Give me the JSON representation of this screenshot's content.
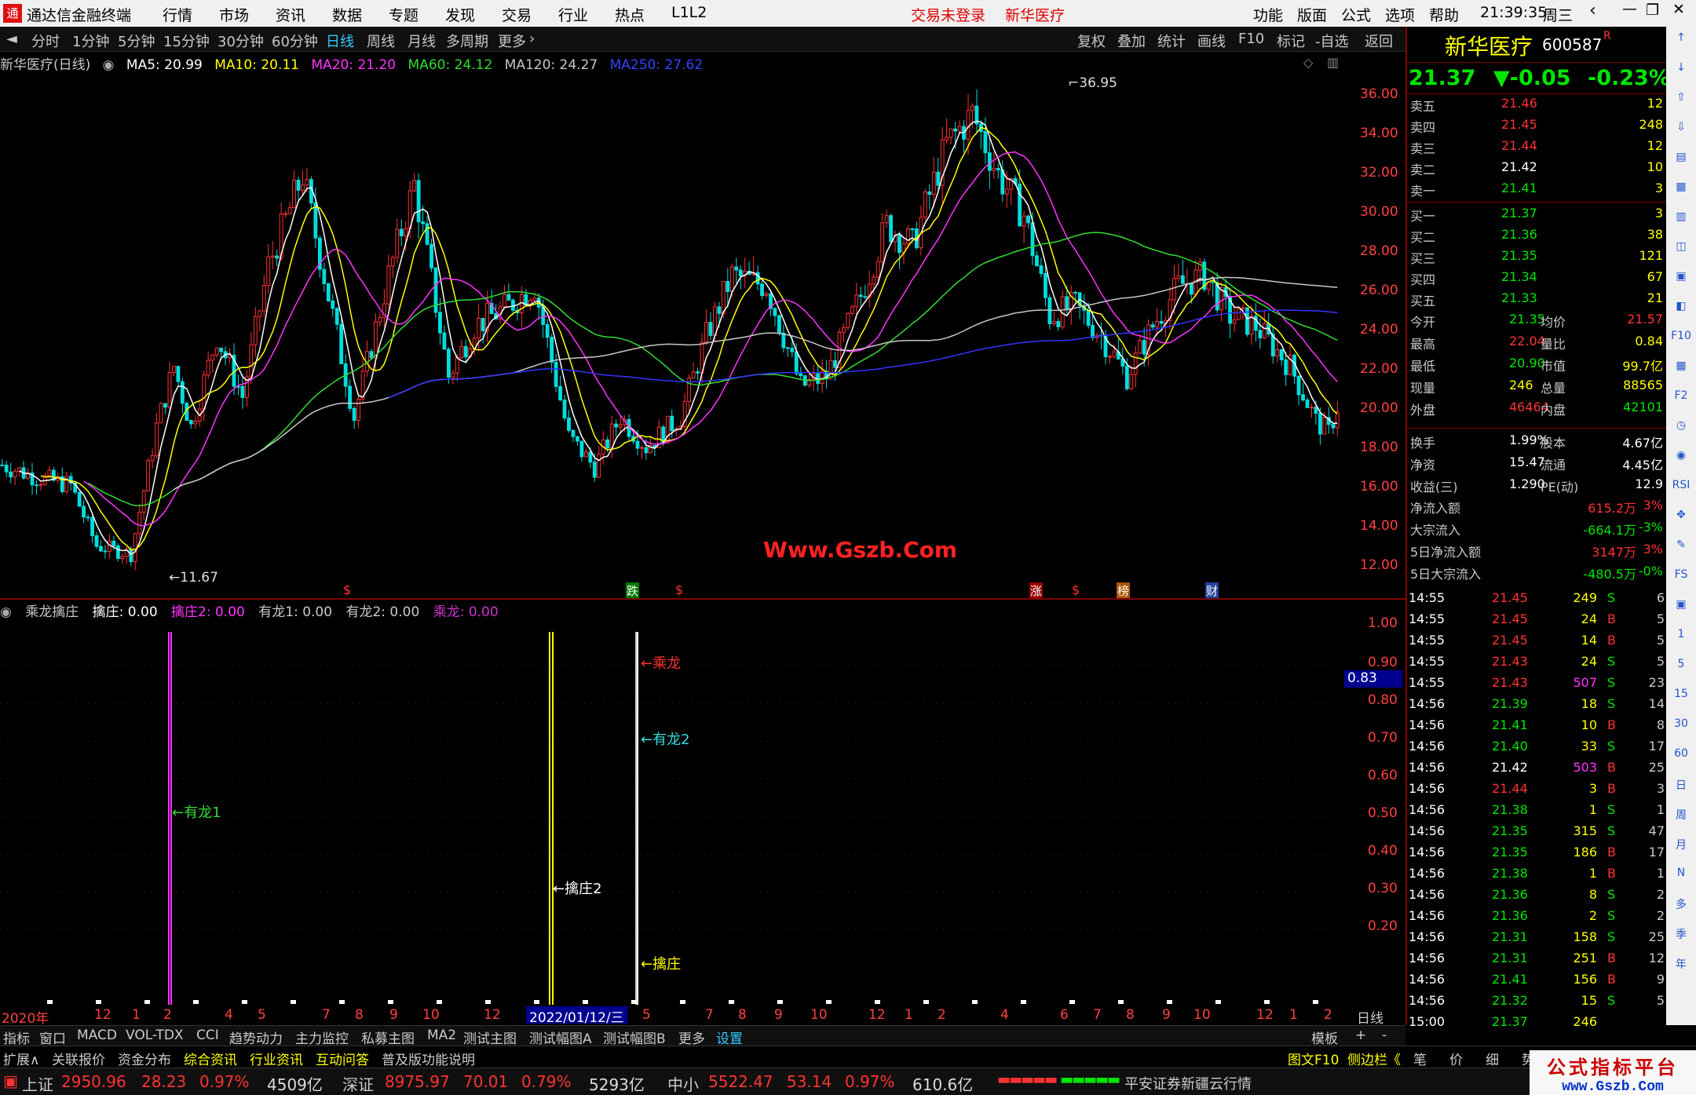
{
  "app": {
    "title": "通达信金融终端",
    "logo_glyph": "通",
    "menu": [
      "行情",
      "市场",
      "资讯",
      "数据",
      "专题",
      "发现",
      "交易",
      "行业",
      "热点",
      "L1L2"
    ],
    "status": [
      "交易未登录",
      "新华医疗"
    ],
    "right_menu": [
      "功能",
      "版面",
      "公式",
      "选项",
      "帮助"
    ],
    "time": "21:39:35",
    "weekday": "周三"
  },
  "timeframes": [
    "分时",
    "1分钟",
    "5分钟",
    "15分钟",
    "30分钟",
    "60分钟",
    "日线",
    "周线",
    "月线",
    "多周期",
    "更多"
  ],
  "active_timeframe": "日线",
  "toolbar": [
    "复权",
    "叠加",
    "统计",
    "画线",
    "F10",
    "标记",
    "-自选",
    "返回"
  ],
  "chart_info": {
    "name": "新华医疗(日线)",
    "ma": [
      {
        "label": "MA5: 20.99",
        "color": "#ffffff"
      },
      {
        "label": "MA10: 20.11",
        "color": "#ffff00"
      },
      {
        "label": "MA20: 21.20",
        "color": "#ff33ff"
      },
      {
        "label": "MA60: 24.12",
        "color": "#33dd33"
      },
      {
        "label": "MA120: 24.27",
        "color": "#c8c8c8"
      },
      {
        "label": "MA250: 27.62",
        "color": "#3333ff"
      }
    ]
  },
  "chart_data": {
    "type": "candlestick",
    "series": [
      {
        "name": "MA5",
        "values": [
          20.99
        ]
      },
      {
        "name": "MA10",
        "values": [
          20.11
        ]
      },
      {
        "name": "MA20",
        "values": [
          21.2
        ]
      },
      {
        "name": "MA60",
        "values": [
          24.12
        ]
      },
      {
        "name": "MA120",
        "values": [
          24.27
        ]
      },
      {
        "name": "MA250",
        "values": [
          27.62
        ]
      }
    ],
    "ylim": [
      11,
      37
    ],
    "y_ticks": [
      "36.00",
      "34.00",
      "32.00",
      "30.00",
      "28.00",
      "26.00",
      "24.00",
      "22.00",
      "20.00",
      "18.00",
      "16.00",
      "14.00",
      "12.00"
    ],
    "annotations": {
      "high": "36.95",
      "low": "11.67"
    },
    "close_path": [
      [
        0,
        17.6
      ],
      [
        8,
        17
      ],
      [
        16,
        16.6
      ],
      [
        22,
        13.6
      ],
      [
        30,
        13.2
      ],
      [
        36,
        19.5
      ],
      [
        40,
        22.5
      ],
      [
        44,
        19.5
      ],
      [
        50,
        24
      ],
      [
        56,
        21
      ],
      [
        62,
        27.5
      ],
      [
        70,
        32
      ],
      [
        76,
        26
      ],
      [
        82,
        20
      ],
      [
        90,
        27
      ],
      [
        96,
        31.5
      ],
      [
        104,
        22
      ],
      [
        110,
        24.5
      ],
      [
        118,
        25.5
      ],
      [
        124,
        26.5
      ],
      [
        132,
        19
      ],
      [
        138,
        17.5
      ],
      [
        144,
        20
      ],
      [
        150,
        18.5
      ],
      [
        158,
        20
      ],
      [
        164,
        24
      ],
      [
        170,
        27
      ],
      [
        178,
        26.5
      ],
      [
        186,
        21.5
      ],
      [
        192,
        22
      ],
      [
        200,
        26
      ],
      [
        206,
        29.5
      ],
      [
        212,
        28.5
      ],
      [
        220,
        33.5
      ],
      [
        226,
        35
      ],
      [
        232,
        32
      ],
      [
        238,
        30
      ],
      [
        244,
        25
      ],
      [
        250,
        25.5
      ],
      [
        256,
        24
      ],
      [
        262,
        22
      ],
      [
        268,
        24.5
      ],
      [
        274,
        26.5
      ],
      [
        280,
        27
      ],
      [
        286,
        25
      ],
      [
        292,
        24.5
      ],
      [
        300,
        22.5
      ],
      [
        306,
        19.8
      ],
      [
        309,
        19.2
      ],
      [
        312,
        21.2
      ]
    ],
    "markers": [
      "$",
      "跌",
      "$",
      "涨",
      "$",
      "榜",
      "财"
    ],
    "watermark": "Www.Gszb.Com"
  },
  "indicator": {
    "title": "乘龙擒庄",
    "values": [
      {
        "label": "擒庄: 0.00",
        "color": "#ffffff"
      },
      {
        "label": "擒庄2: 0.00",
        "color": "#ff33ff"
      },
      {
        "label": "有龙1: 0.00",
        "color": "#c8c8c8"
      },
      {
        "label": "有龙2: 0.00",
        "color": "#c8c8c8"
      },
      {
        "label": "乘龙: 0.00",
        "color": "#cc33cc"
      }
    ],
    "y_ticks": [
      "1.00",
      "0.90",
      "0.80",
      "0.70",
      "0.60",
      "0.50",
      "0.40",
      "0.30",
      "0.20"
    ],
    "cursor_value": "0.83",
    "labels": {
      "youlong1": "←有龙1",
      "qinzhuang2": "←擒庄2",
      "chenglong": "←乘龙",
      "youlong2": "←有龙2",
      "qinzhuang": "←擒庄"
    }
  },
  "time_axis": {
    "labels": [
      "2020年",
      "12",
      "1",
      "2",
      "4",
      "5",
      "7",
      "8",
      "9",
      "10",
      "12",
      "2022/01/12/三",
      "5",
      "7",
      "8",
      "9",
      "10",
      "12",
      "1",
      "2",
      "4",
      "6",
      "7",
      "8",
      "9",
      "10",
      "12",
      "1",
      "2"
    ],
    "period": "日线"
  },
  "indicator_tabs": [
    "指标",
    "窗口",
    "MACD",
    "VOL-TDX",
    "CCI",
    "趋势动力",
    "主力监控",
    "私募主图",
    "MA2",
    "测试主图",
    "测试幅图A",
    "测试幅图B",
    "更多",
    "设置"
  ],
  "right_tabs": [
    "模板",
    "+",
    "-"
  ],
  "ext_tabs": [
    "扩展∧",
    "关联报价",
    "资金分布",
    "综合资讯",
    "行业资讯",
    "互动问答",
    "普及版功能说明"
  ],
  "side_tabs": [
    "图文F10",
    "侧边栏《",
    "笔",
    "价",
    "细",
    "势"
  ],
  "stock": {
    "name": "新华医疗",
    "code": "600587",
    "suffix": "R",
    "price": "21.37",
    "change": "▼-0.05",
    "pct": "-0.23%"
  },
  "order_book": {
    "asks": [
      [
        "卖五",
        "21.46",
        "12"
      ],
      [
        "卖四",
        "21.45",
        "248"
      ],
      [
        "卖三",
        "21.44",
        "12"
      ],
      [
        "卖二",
        "21.42",
        "10"
      ],
      [
        "卖一",
        "21.41",
        "3"
      ]
    ],
    "bids": [
      [
        "买一",
        "21.37",
        "3"
      ],
      [
        "买二",
        "21.36",
        "38"
      ],
      [
        "买三",
        "21.35",
        "121"
      ],
      [
        "买四",
        "21.34",
        "67"
      ],
      [
        "买五",
        "21.33",
        "21"
      ]
    ]
  },
  "stats": [
    [
      "今开",
      "21.35",
      "均价",
      "21.57"
    ],
    [
      "最高",
      "22.04",
      "量比",
      "0.84"
    ],
    [
      "最低",
      "20.90",
      "市值",
      "99.7亿"
    ],
    [
      "现量",
      "246",
      "总量",
      "88565"
    ],
    [
      "外盘",
      "46464",
      "内盘",
      "42101"
    ]
  ],
  "stats2": [
    [
      "换手",
      "1.99%",
      "股本",
      "4.67亿"
    ],
    [
      "净资",
      "15.47",
      "流通",
      "4.45亿"
    ],
    [
      "收益(三)",
      "1.290",
      "PE(动)",
      "12.9"
    ]
  ],
  "flows": [
    [
      "净流入额",
      "615.2万",
      "3%"
    ],
    [
      "大宗流入",
      "-664.1万",
      "-3%"
    ],
    [
      "5日净流入额",
      "3147万",
      "3%"
    ],
    [
      "5日大宗流入",
      "-480.5万",
      "-0%"
    ]
  ],
  "ticks": [
    [
      "14:55",
      "21.45",
      "249",
      "S",
      "6"
    ],
    [
      "14:55",
      "21.45",
      "24",
      "B",
      "5"
    ],
    [
      "14:55",
      "21.45",
      "14",
      "B",
      "5"
    ],
    [
      "14:55",
      "21.43",
      "24",
      "S",
      "5"
    ],
    [
      "14:55",
      "21.43",
      "507",
      "S",
      "23"
    ],
    [
      "14:56",
      "21.39",
      "18",
      "S",
      "14"
    ],
    [
      "14:56",
      "21.41",
      "10",
      "B",
      "8"
    ],
    [
      "14:56",
      "21.40",
      "33",
      "S",
      "17"
    ],
    [
      "14:56",
      "21.42",
      "503",
      "B",
      "25"
    ],
    [
      "14:56",
      "21.44",
      "3",
      "B",
      "3"
    ],
    [
      "14:56",
      "21.38",
      "1",
      "S",
      "1"
    ],
    [
      "14:56",
      "21.35",
      "315",
      "S",
      "47"
    ],
    [
      "14:56",
      "21.35",
      "186",
      "B",
      "17"
    ],
    [
      "14:56",
      "21.38",
      "1",
      "B",
      "1"
    ],
    [
      "14:56",
      "21.36",
      "8",
      "S",
      "2"
    ],
    [
      "14:56",
      "21.36",
      "2",
      "S",
      "2"
    ],
    [
      "14:56",
      "21.31",
      "158",
      "S",
      "25"
    ],
    [
      "14:56",
      "21.31",
      "251",
      "B",
      "12"
    ],
    [
      "14:56",
      "21.41",
      "156",
      "B",
      "9"
    ],
    [
      "14:56",
      "21.32",
      "15",
      "S",
      "5"
    ],
    [
      "15:00",
      "21.37",
      "246",
      "",
      ""
    ]
  ],
  "right_tools": [
    "↑",
    "↓",
    "⇧",
    "⇩",
    "▤",
    "▦",
    "▥",
    "◫",
    "▣",
    "◧",
    "F10",
    "▦",
    "F2",
    "◷",
    "◉",
    "RSI",
    "✥",
    "✎",
    "FS",
    "▣",
    "1",
    "5",
    "15",
    "30",
    "60",
    "日",
    "周",
    "月",
    "N",
    "多",
    "季",
    "年"
  ],
  "index_bar": [
    {
      "name": "上证",
      "value": "2950.96",
      "chg": "28.23",
      "pct": "0.97%",
      "amt": "4509亿"
    },
    {
      "name": "深证",
      "value": "8975.97",
      "chg": "70.01",
      "pct": "0.79%",
      "amt": "5293亿"
    },
    {
      "name": "中小",
      "value": "5522.47",
      "chg": "53.14",
      "pct": "0.97%",
      "amt": "610.6亿"
    }
  ],
  "broker": "平安证券新疆云行情",
  "brand": "公式指标平台",
  "brand_url": "www.Gszb.Com",
  "colors": {
    "up": "#ff3232",
    "down": "#00e600",
    "yellow": "#ffff00",
    "blue_axis": "#000080"
  }
}
